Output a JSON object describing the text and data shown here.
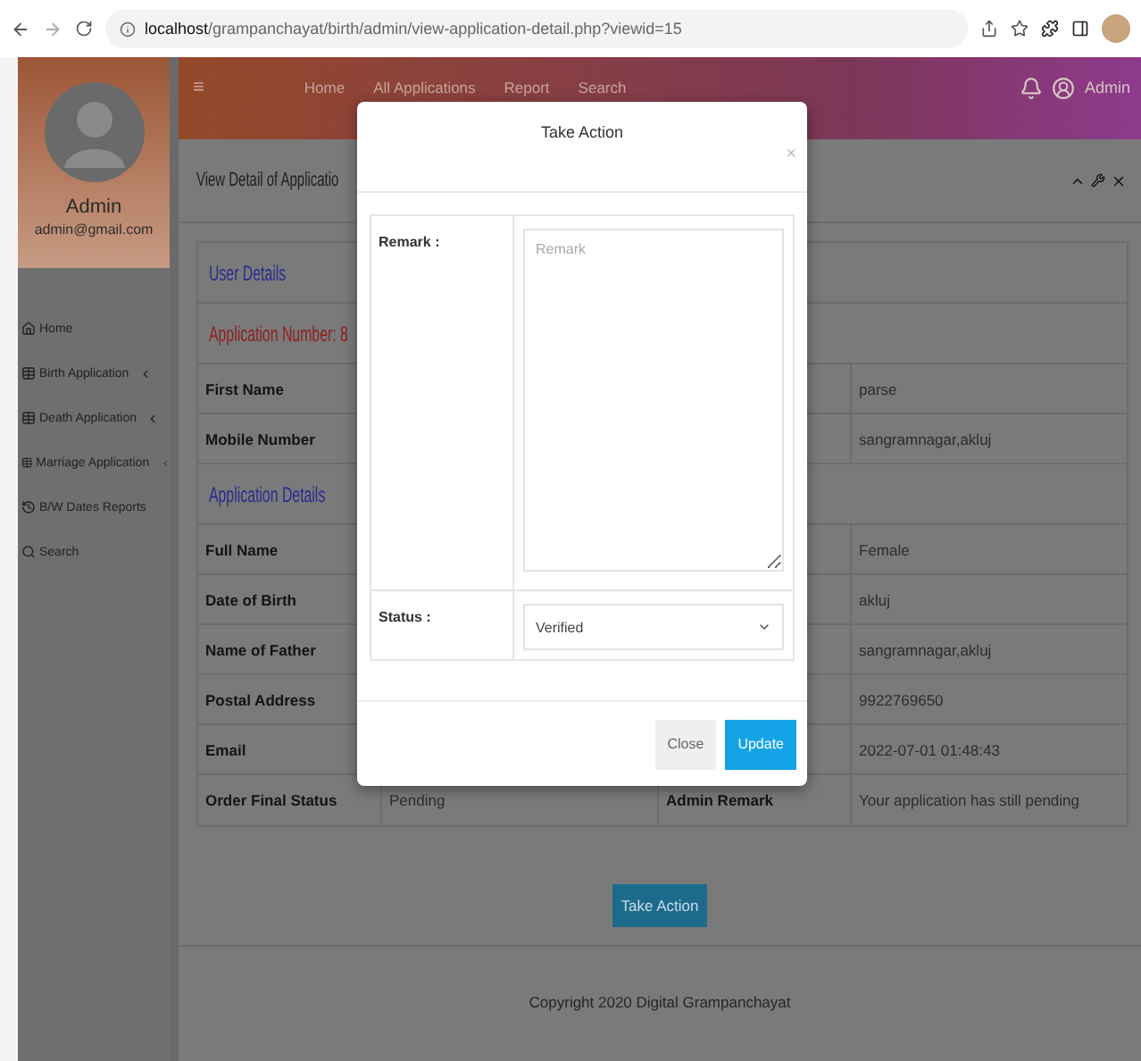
{
  "browser": {
    "url_host": "localhost",
    "url_path": "/grampanchayat/birth/admin/view-application-detail.php?viewid=15"
  },
  "topbar": {
    "menu": "≡",
    "nav": [
      "Home",
      "All Applications",
      "Report",
      "Search"
    ],
    "user": "Admin"
  },
  "sidebar": {
    "name": "Admin",
    "email": "admin@gmail.com",
    "items": [
      {
        "kind": "home",
        "label": "Home"
      },
      {
        "kind": "submenu",
        "label": "Birth Application"
      },
      {
        "kind": "submenu",
        "label": "Death Application"
      },
      {
        "kind": "submenu",
        "label": "Marriage Application"
      },
      {
        "kind": "report",
        "label": "B/W Dates Reports"
      },
      {
        "kind": "search",
        "label": "Search"
      }
    ]
  },
  "panel": {
    "title": "View Detail of Applicatio"
  },
  "details": [
    {
      "kind": "heading",
      "text": "User Details",
      "color": "#2a2a8e"
    },
    {
      "kind": "heading",
      "text": "Application Number: 8",
      "color": "#8e2020"
    },
    {
      "kind": "row",
      "column_1": "First Name",
      "column_4": "parse"
    },
    {
      "kind": "row",
      "column_1": "Mobile Number",
      "column_4": "sangramnagar,akluj"
    },
    {
      "kind": "heading",
      "text": "Application Details",
      "color": "#2a2a8e"
    },
    {
      "kind": "row",
      "column_1": "Full Name",
      "column_4": "Female"
    },
    {
      "kind": "row",
      "column_1": "Date of Birth",
      "column_4": "akluj"
    },
    {
      "kind": "row",
      "column_1": "Name of Father",
      "column_4": "sangramnagar,akluj"
    },
    {
      "kind": "row",
      "column_1": "Postal Address",
      "column_4": "9922769650"
    },
    {
      "kind": "row",
      "column_1": "Email",
      "column_4": "2022-07-01 01:48:43"
    },
    {
      "kind": "row",
      "column_1": "Order Final Status",
      "column_2": "Pending",
      "column_3": "Admin Remark",
      "column_4": "Your application has still pending"
    }
  ],
  "action_button": "Take Action",
  "footer": "Copyright 2020 Digital Grampanchayat",
  "modal": {
    "title": "Take Action",
    "close": "×",
    "remark_label": "Remark :",
    "remark_placeholder": "Remark",
    "status_label": "Status :",
    "status_value": "Verified",
    "buttons": [
      {
        "kind": "default",
        "label": "Close"
      },
      {
        "kind": "primary",
        "label": "Update"
      }
    ]
  }
}
